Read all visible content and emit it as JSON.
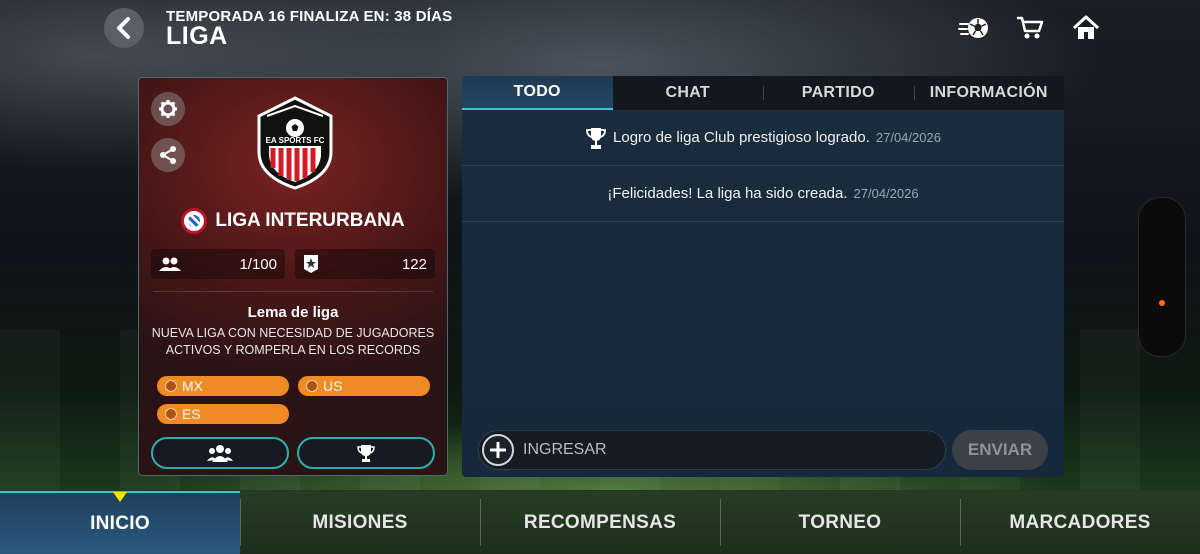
{
  "header": {
    "season_text": "TEMPORADA 16 FINALIZA EN: 38 DÍAS",
    "title": "LIGA",
    "icons": [
      "back-arrow-icon",
      "soccer-ball-icon",
      "cart-icon",
      "home-icon"
    ]
  },
  "league": {
    "crest_text": "EA SPORTS FC",
    "name": "LIGA INTERURBANA",
    "members": "1/100",
    "rating": "122",
    "motto_title": "Lema de liga",
    "motto_text": "NUEVA LIGA CON NECESIDAD DE JUGADORES ACTIVOS Y ROMPERLA EN LOS RECORDS",
    "regions": [
      "MX",
      "US",
      "ES"
    ],
    "colors": {
      "card": "#4a1717",
      "region_tag": "#f08a24",
      "accent": "#2ab0b0"
    }
  },
  "feed": {
    "tabs": [
      "TODO",
      "CHAT",
      "PARTIDO",
      "INFORMACIÓN"
    ],
    "active_tab": "TODO",
    "items": [
      {
        "icon": "trophy-icon",
        "text": "Logro de liga Club prestigioso logrado.",
        "date": "27/04/2026"
      },
      {
        "icon": "",
        "text": "¡Felicidades! La liga ha sido creada.",
        "date": "27/04/2026"
      }
    ],
    "input_placeholder": "INGRESAR",
    "send_label": "ENVIAR"
  },
  "bottom_nav": {
    "items": [
      "INICIO",
      "MISIONES",
      "RECOMPENSAS",
      "TORNEO",
      "MARCADORES"
    ],
    "active": "INICIO"
  }
}
